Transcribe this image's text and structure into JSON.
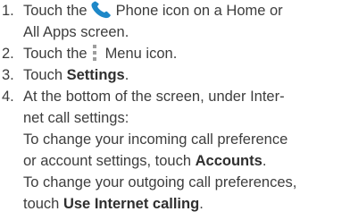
{
  "steps": [
    {
      "number": "1.",
      "before_icon": "Touch the",
      "icon": "phone-icon",
      "after_icon": "Phone icon on a Home or",
      "continuation": "All Apps screen."
    },
    {
      "number": "2.",
      "before_icon": "Touch the",
      "icon": "menu-icon",
      "after_icon": "Menu icon."
    },
    {
      "number": "3.",
      "before_bold": "Touch",
      "bold": "Settings",
      "after_bold": "."
    },
    {
      "number": "4.",
      "line1": "At the bottom of the screen, under Inter-",
      "line2": "net call settings:",
      "incoming_text": "To change your incoming call preference",
      "incoming_text2_before": "or account settings, touch",
      "incoming_bold": "Accounts",
      "incoming_after": ".",
      "outgoing_text": "To change your outgoing call preferences,",
      "outgoing_text2_before": "touch",
      "outgoing_bold": "Use Internet calling",
      "outgoing_after": "."
    }
  ],
  "colors": {
    "text": "#3d3d3d",
    "phone_icon": "#1e88c8",
    "menu_icon": "#9e9e9e"
  }
}
